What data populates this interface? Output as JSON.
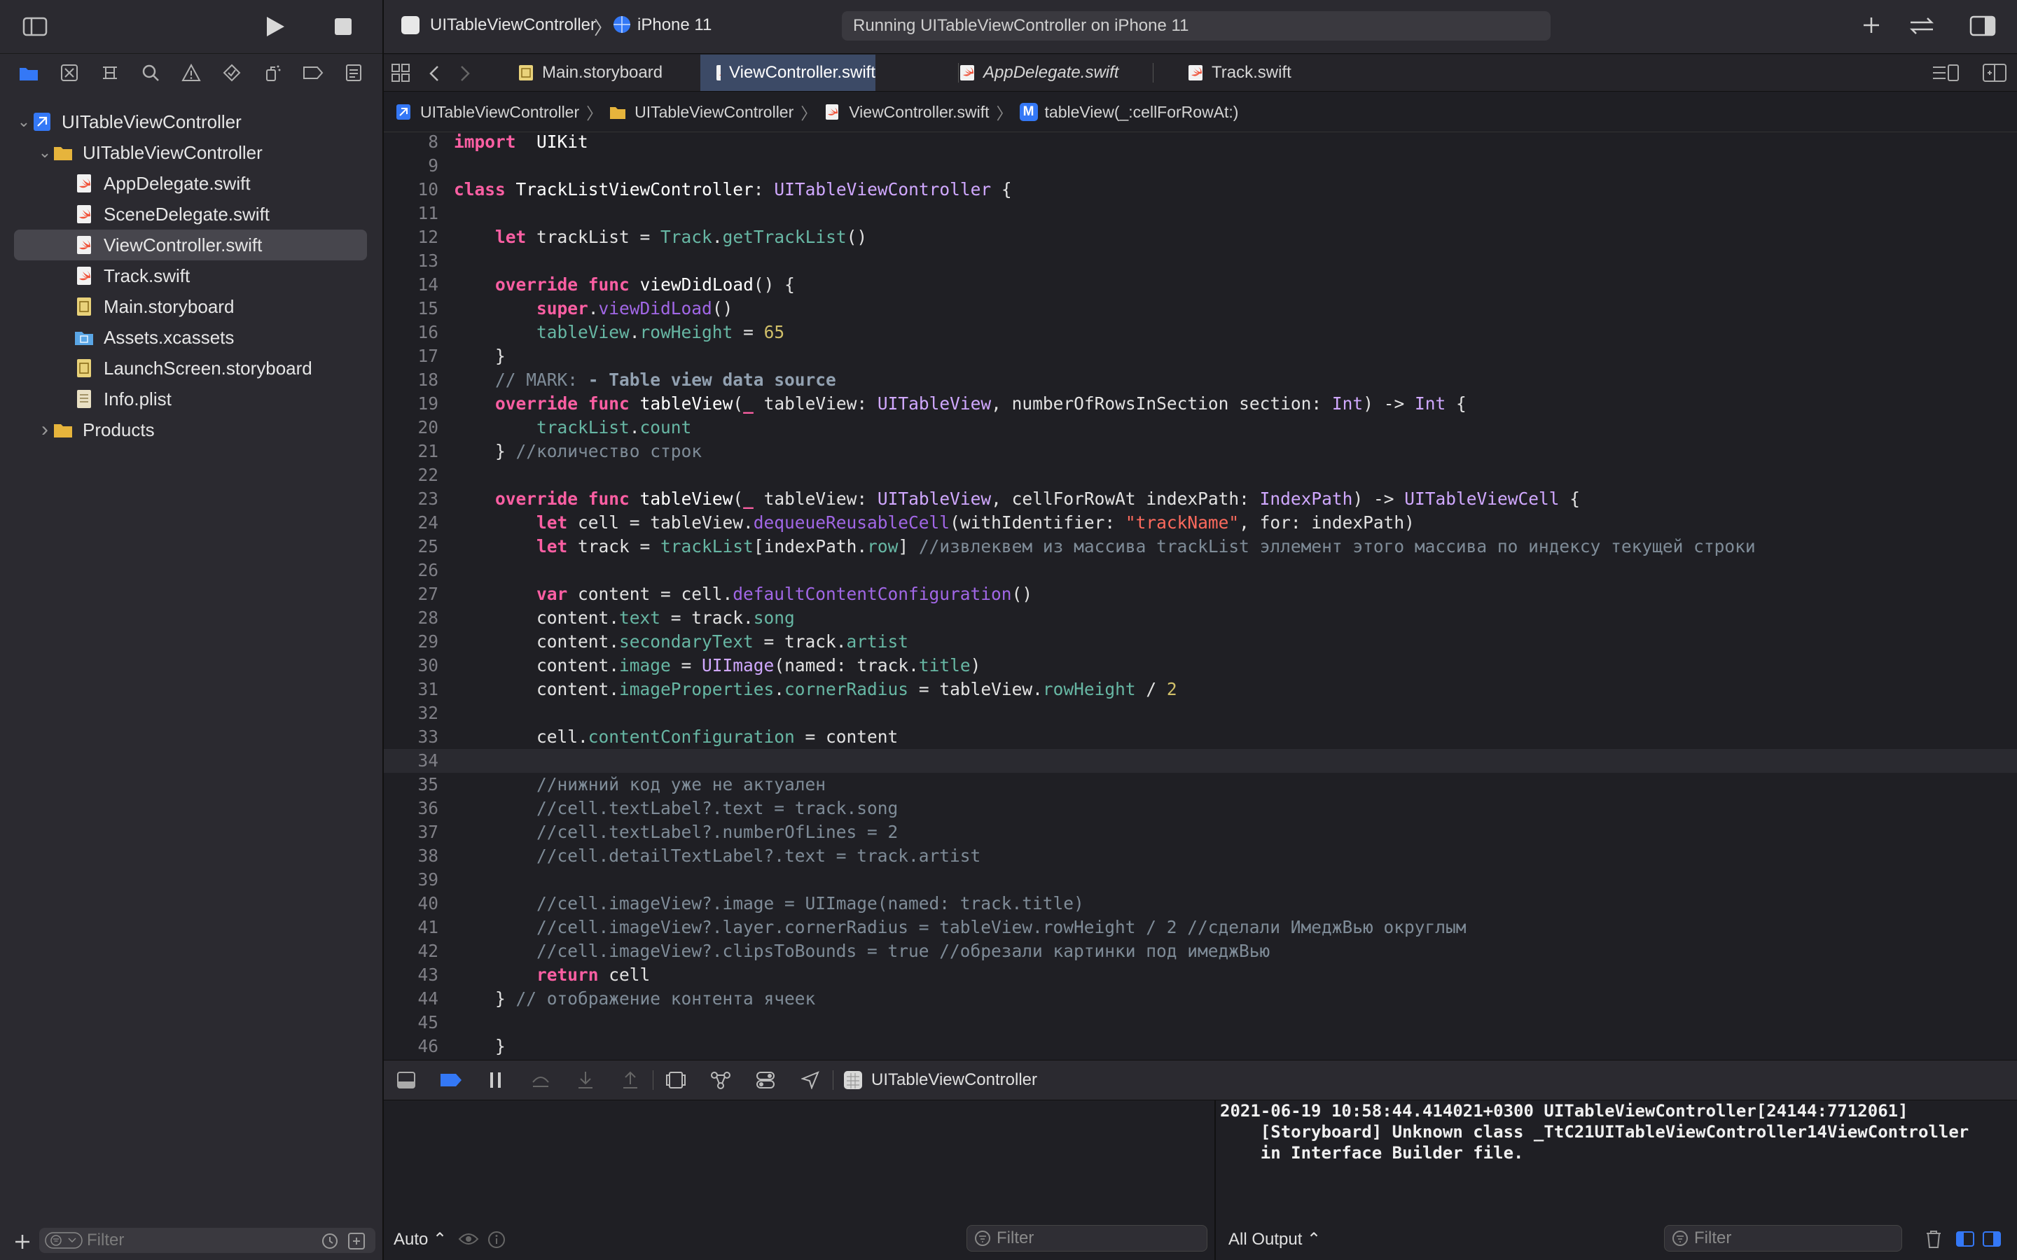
{
  "project_tree": {
    "items": [
      {
        "label": "UITableViewController",
        "depth": 0,
        "icon": "xcode-project-icon",
        "expanded": true
      },
      {
        "label": "UITableViewController",
        "depth": 1,
        "icon": "folder-icon",
        "expanded": true
      },
      {
        "label": "AppDelegate.swift",
        "depth": 2,
        "icon": "swift-file-icon"
      },
      {
        "label": "SceneDelegate.swift",
        "depth": 2,
        "icon": "swift-file-icon"
      },
      {
        "label": "ViewController.swift",
        "depth": 2,
        "icon": "swift-file-icon",
        "selected": true
      },
      {
        "label": "Track.swift",
        "depth": 2,
        "icon": "swift-file-icon"
      },
      {
        "label": "Main.storyboard",
        "depth": 2,
        "icon": "storyboard-icon"
      },
      {
        "label": "Assets.xcassets",
        "depth": 2,
        "icon": "assets-folder-icon"
      },
      {
        "label": "LaunchScreen.storyboard",
        "depth": 2,
        "icon": "storyboard-icon"
      },
      {
        "label": "Info.plist",
        "depth": 2,
        "icon": "plist-file-icon"
      },
      {
        "label": "Products",
        "depth": 1,
        "icon": "folder-icon",
        "expanded": false
      }
    ],
    "filter_placeholder": "Filter"
  },
  "toolbar": {
    "scheme": "UITableViewController",
    "device": "iPhone 11",
    "status": "Running UITableViewController on iPhone 11"
  },
  "tabs": [
    {
      "label": "Main.storyboard",
      "active": false,
      "italic": false
    },
    {
      "label": "ViewController.swift",
      "active": true,
      "italic": false
    },
    {
      "label": "AppDelegate.swift",
      "active": false,
      "italic": true
    },
    {
      "label": "Track.swift",
      "active": false,
      "italic": false
    }
  ],
  "breadcrumb": [
    "UITableViewController",
    "UITableViewController",
    "ViewController.swift",
    "tableView(_:cellForRowAt:)"
  ],
  "breadcrumb_method_badge": "M",
  "editor": {
    "current_line": 34,
    "lines": [
      {
        "n": "8",
        "t": [
          [
            "kw",
            "import"
          ],
          [
            "",
            "  "
          ],
          [
            "def",
            "UIKit"
          ]
        ]
      },
      {
        "n": "9",
        "t": []
      },
      {
        "n": "10",
        "t": [
          [
            "kw",
            "class"
          ],
          [
            "",
            " "
          ],
          [
            "def",
            "TrackListViewController"
          ],
          [
            "",
            ": "
          ],
          [
            "ty",
            "UITableViewController"
          ],
          [
            "",
            " {"
          ]
        ]
      },
      {
        "n": "11",
        "t": []
      },
      {
        "n": "12",
        "t": [
          [
            "",
            "    "
          ],
          [
            "kw",
            "let"
          ],
          [
            "",
            " trackList = "
          ],
          [
            "pr",
            "Track"
          ],
          [
            "",
            "."
          ],
          [
            "pr",
            "getTrackList"
          ],
          [
            "",
            "()"
          ]
        ]
      },
      {
        "n": "13",
        "t": []
      },
      {
        "n": "14",
        "t": [
          [
            "",
            "    "
          ],
          [
            "kw",
            "override"
          ],
          [
            "",
            " "
          ],
          [
            "kw",
            "func"
          ],
          [
            "",
            " "
          ],
          [
            "def",
            "viewDidLoad"
          ],
          [
            "",
            "() {"
          ]
        ]
      },
      {
        "n": "15",
        "t": [
          [
            "",
            "        "
          ],
          [
            "kw",
            "super"
          ],
          [
            "",
            "."
          ],
          [
            "fn",
            "viewDidLoad"
          ],
          [
            "",
            "()"
          ]
        ]
      },
      {
        "n": "16",
        "t": [
          [
            "",
            "        "
          ],
          [
            "pr",
            "tableView"
          ],
          [
            "",
            "."
          ],
          [
            "pr",
            "rowHeight"
          ],
          [
            "",
            " = "
          ],
          [
            "nu",
            "65"
          ]
        ]
      },
      {
        "n": "17",
        "t": [
          [
            "",
            "    }"
          ]
        ]
      },
      {
        "n": "18",
        "t": [
          [
            "",
            "    "
          ],
          [
            "cm",
            "// MARK: "
          ],
          [
            "mk",
            "- Table view data source"
          ]
        ]
      },
      {
        "n": "19",
        "t": [
          [
            "",
            "    "
          ],
          [
            "kw",
            "override"
          ],
          [
            "",
            " "
          ],
          [
            "kw",
            "func"
          ],
          [
            "",
            " "
          ],
          [
            "def",
            "tableView"
          ],
          [
            "",
            "("
          ],
          [
            "kw",
            "_"
          ],
          [
            "",
            " tableView: "
          ],
          [
            "ty",
            "UITableView"
          ],
          [
            "",
            ", numberOfRowsInSection section: "
          ],
          [
            "ty",
            "Int"
          ],
          [
            "",
            ") -> "
          ],
          [
            "ty",
            "Int"
          ],
          [
            "",
            " {"
          ]
        ]
      },
      {
        "n": "20",
        "t": [
          [
            "",
            "        "
          ],
          [
            "pr",
            "trackList"
          ],
          [
            "",
            "."
          ],
          [
            "pr",
            "count"
          ]
        ]
      },
      {
        "n": "21",
        "t": [
          [
            "",
            "    } "
          ],
          [
            "cm",
            "//количество строк"
          ]
        ]
      },
      {
        "n": "22",
        "t": []
      },
      {
        "n": "23",
        "t": [
          [
            "",
            "    "
          ],
          [
            "kw",
            "override"
          ],
          [
            "",
            " "
          ],
          [
            "kw",
            "func"
          ],
          [
            "",
            " "
          ],
          [
            "def",
            "tableView"
          ],
          [
            "",
            "("
          ],
          [
            "kw",
            "_"
          ],
          [
            "",
            " tableView: "
          ],
          [
            "ty",
            "UITableView"
          ],
          [
            "",
            ", cellForRowAt indexPath: "
          ],
          [
            "ty",
            "IndexPath"
          ],
          [
            "",
            ") -> "
          ],
          [
            "ty",
            "UITableViewCell"
          ],
          [
            "",
            " {"
          ]
        ]
      },
      {
        "n": "24",
        "t": [
          [
            "",
            "        "
          ],
          [
            "kw",
            "let"
          ],
          [
            "",
            " cell = tableView."
          ],
          [
            "fn",
            "dequeueReusableCell"
          ],
          [
            "",
            "(withIdentifier: "
          ],
          [
            "st",
            "\"trackName\""
          ],
          [
            "",
            ", for: indexPath)"
          ]
        ]
      },
      {
        "n": "25",
        "t": [
          [
            "",
            "        "
          ],
          [
            "kw",
            "let"
          ],
          [
            "",
            " track = "
          ],
          [
            "pr",
            "trackList"
          ],
          [
            "",
            "[indexPath."
          ],
          [
            "pr",
            "row"
          ],
          [
            "",
            "] "
          ],
          [
            "cm",
            "//извлеквем из массива trackList эллемент этого массива по индексу текущей строки"
          ]
        ]
      },
      {
        "n": "26",
        "t": []
      },
      {
        "n": "27",
        "t": [
          [
            "",
            "        "
          ],
          [
            "kw",
            "var"
          ],
          [
            "",
            " content = cell."
          ],
          [
            "fn",
            "defaultContentConfiguration"
          ],
          [
            "",
            "()"
          ]
        ]
      },
      {
        "n": "28",
        "t": [
          [
            "",
            "        content."
          ],
          [
            "pr",
            "text"
          ],
          [
            "",
            " = track."
          ],
          [
            "pr",
            "song"
          ]
        ]
      },
      {
        "n": "29",
        "t": [
          [
            "",
            "        content."
          ],
          [
            "pr",
            "secondaryText"
          ],
          [
            "",
            " = track."
          ],
          [
            "pr",
            "artist"
          ]
        ]
      },
      {
        "n": "30",
        "t": [
          [
            "",
            "        content."
          ],
          [
            "pr",
            "image"
          ],
          [
            "",
            " = "
          ],
          [
            "ty",
            "UIImage"
          ],
          [
            "",
            "(named: track."
          ],
          [
            "pr",
            "title"
          ],
          [
            "",
            ")"
          ]
        ]
      },
      {
        "n": "31",
        "t": [
          [
            "",
            "        content."
          ],
          [
            "pr",
            "imageProperties"
          ],
          [
            "",
            "."
          ],
          [
            "pr",
            "cornerRadius"
          ],
          [
            "",
            " = tableView."
          ],
          [
            "pr",
            "rowHeight"
          ],
          [
            "",
            " / "
          ],
          [
            "nu",
            "2"
          ]
        ]
      },
      {
        "n": "32",
        "t": []
      },
      {
        "n": "33",
        "t": [
          [
            "",
            "        cell."
          ],
          [
            "pr",
            "contentConfiguration"
          ],
          [
            "",
            " = content"
          ]
        ]
      },
      {
        "n": "34",
        "t": []
      },
      {
        "n": "35",
        "t": [
          [
            "",
            "        "
          ],
          [
            "cm",
            "//нижний код уже не актуален"
          ]
        ]
      },
      {
        "n": "36",
        "t": [
          [
            "",
            "        "
          ],
          [
            "cm",
            "//cell.textLabel?.text = track.song"
          ]
        ]
      },
      {
        "n": "37",
        "t": [
          [
            "",
            "        "
          ],
          [
            "cm",
            "//cell.textLabel?.numberOfLines = 2"
          ]
        ]
      },
      {
        "n": "38",
        "t": [
          [
            "",
            "        "
          ],
          [
            "cm",
            "//cell.detailTextLabel?.text = track.artist"
          ]
        ]
      },
      {
        "n": "39",
        "t": []
      },
      {
        "n": "40",
        "t": [
          [
            "",
            "        "
          ],
          [
            "cm",
            "//cell.imageView?.image = UIImage(named: track.title)"
          ]
        ]
      },
      {
        "n": "41",
        "t": [
          [
            "",
            "        "
          ],
          [
            "cm",
            "//cell.imageView?.layer.cornerRadius = tableView.rowHeight / 2 //сделали ИмеджВью округлым"
          ]
        ]
      },
      {
        "n": "42",
        "t": [
          [
            "",
            "        "
          ],
          [
            "cm",
            "//cell.imageView?.clipsToBounds = true //обрезали картинки под имеджВью"
          ]
        ]
      },
      {
        "n": "43",
        "t": [
          [
            "",
            "        "
          ],
          [
            "kw",
            "return"
          ],
          [
            "",
            " cell"
          ]
        ]
      },
      {
        "n": "44",
        "t": [
          [
            "",
            "    } "
          ],
          [
            "cm",
            "// отображение контента ячеек"
          ]
        ]
      },
      {
        "n": "45",
        "t": []
      },
      {
        "n": "46",
        "t": [
          [
            "",
            "    }"
          ]
        ]
      }
    ]
  },
  "debug_bar": {
    "target": "UITableViewController"
  },
  "variables": {
    "scope_label": "Auto ⌃",
    "filter_placeholder": "Filter"
  },
  "console": {
    "output_label": "All Output ⌃",
    "filter_placeholder": "Filter",
    "text": "2021-06-19 10:58:44.414021+0300 UITableViewController[24144:7712061]\n    [Storyboard] Unknown class _TtC21UITableViewController14ViewController\n    in Interface Builder file."
  },
  "colors": {
    "accent": "#3478f6",
    "swift_orange": "#f05138",
    "folder_yellow": "#e6b43c",
    "selected_tab": "#3c4a66"
  }
}
